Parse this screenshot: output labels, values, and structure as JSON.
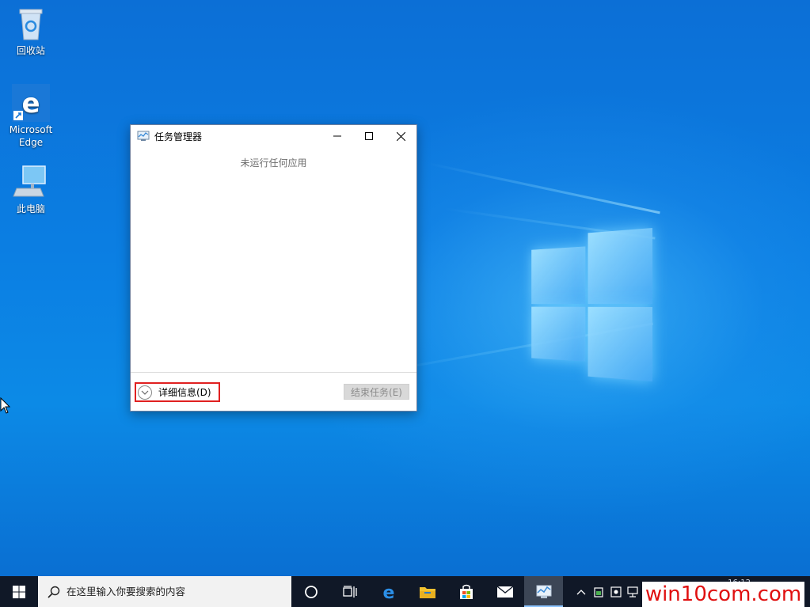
{
  "desktop": {
    "icons": [
      {
        "label": "回收站",
        "icon": "recycle-bin-icon"
      },
      {
        "label": "Microsoft Edge",
        "icon": "edge-icon"
      },
      {
        "label": "此电脑",
        "icon": "computer-icon"
      }
    ]
  },
  "window": {
    "title": "任务管理器",
    "empty_message": "未运行任何应用",
    "details_label": "详细信息(D)",
    "end_task_label": "结束任务(E)"
  },
  "taskbar": {
    "search_placeholder": "在这里输入你要搜索的内容",
    "clock_time": "16:12"
  },
  "watermark": "win10com.com",
  "colors": {
    "accent": "#0b7fe3",
    "taskbar_bg": "#101827",
    "highlight_border": "#e02020",
    "watermark": "#e01010"
  }
}
